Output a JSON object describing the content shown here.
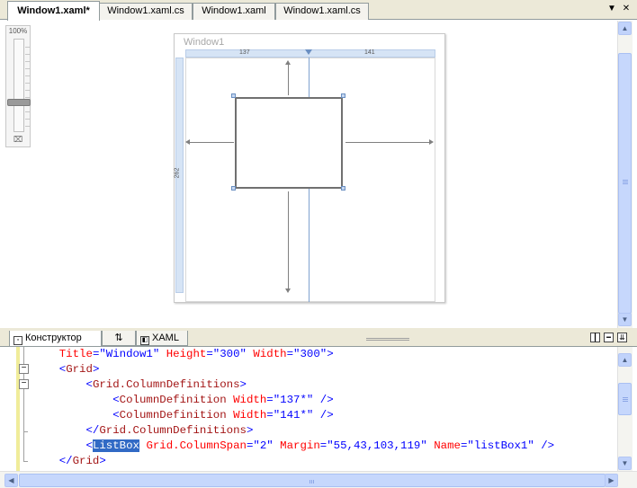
{
  "tabs": [
    {
      "label": "Window1.xaml*",
      "active": true
    },
    {
      "label": "Window1.xaml.cs",
      "active": false
    },
    {
      "label": "Window1.xaml",
      "active": false
    },
    {
      "label": "Window1.xaml.cs",
      "active": false
    }
  ],
  "tabstrip_buttons": {
    "dropdown": "▼",
    "close": "✕"
  },
  "designer": {
    "zoom_label": "100%",
    "zoom_level_fraction": 0.7,
    "window_title": "Window1",
    "column_widths": [
      "137",
      "141"
    ],
    "grid_height": "262"
  },
  "view_tabs": {
    "design": "Конструктор",
    "swap": "⇅",
    "xaml": "XAML"
  },
  "code": {
    "line1": {
      "attr1": "Title",
      "val1": "\"Window1\"",
      "attr2": "Height",
      "val2": "\"300\"",
      "attr3": "Width",
      "val3": "\"300\"",
      "close": ">"
    },
    "line2": {
      "open": "<",
      "el": "Grid",
      "close": ">"
    },
    "line3": {
      "open": "<",
      "el": "Grid.ColumnDefinitions",
      "close": ">"
    },
    "line4": {
      "open": "<",
      "el": "ColumnDefinition",
      "attr": "Width",
      "val": "\"137*\"",
      "close": "/>"
    },
    "line5": {
      "open": "<",
      "el": "ColumnDefinition",
      "attr": "Width",
      "val": "\"141*\"",
      "close": "/>"
    },
    "line6": {
      "open": "</",
      "el": "Grid.ColumnDefinitions",
      "close": ">"
    },
    "line7": {
      "open": "<",
      "el": "ListBox",
      "attr1": "Grid.ColumnSpan",
      "val1": "\"2\"",
      "attr2": "Margin",
      "val2": "\"55,43,103,119\"",
      "attr3": "Name",
      "val3": "\"listBox1\"",
      "close": "/>"
    },
    "line8": {
      "open": "</",
      "el": "Grid",
      "close": ">"
    }
  },
  "colors": {
    "keyword": "#0000ff",
    "element": "#a31515",
    "attribute": "#ff0000",
    "selection": "#316ac5"
  }
}
